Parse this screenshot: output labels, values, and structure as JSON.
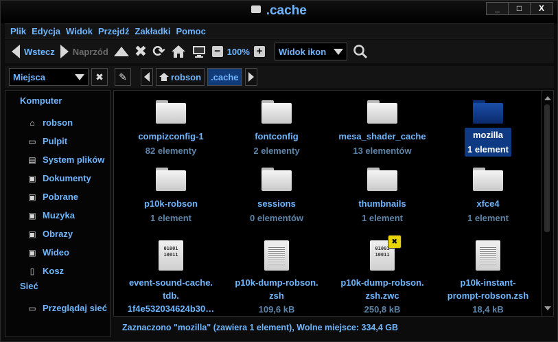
{
  "window": {
    "title": " .cache",
    "controls": [
      "_",
      "□",
      "X"
    ]
  },
  "menu": [
    "Plik",
    "Edycja",
    "Widok",
    "Przejdź",
    "Zakładki",
    "Pomoc"
  ],
  "toolbar": {
    "back": "Wstecz",
    "forward": "Naprzód",
    "zoom": "100%",
    "view_mode": "Widok ikon"
  },
  "location": {
    "places": "Miejsca",
    "crumbs": [
      "robson",
      ".cache"
    ]
  },
  "sidebar": {
    "computer_heading": "Komputer",
    "computer_items": [
      {
        "label": "robson",
        "icon": "home-icon"
      },
      {
        "label": "Pulpit",
        "icon": "desktop-icon"
      },
      {
        "label": "System plików",
        "icon": "drive-icon"
      },
      {
        "label": "Dokumenty",
        "icon": "documents-icon"
      },
      {
        "label": "Pobrane",
        "icon": "downloads-icon"
      },
      {
        "label": "Muzyka",
        "icon": "music-icon"
      },
      {
        "label": "Obrazy",
        "icon": "pictures-icon"
      },
      {
        "label": "Wideo",
        "icon": "video-icon"
      },
      {
        "label": "Kosz",
        "icon": "trash-icon"
      }
    ],
    "network_heading": "Sieć",
    "network_items": [
      {
        "label": "Przeglądaj sieć",
        "icon": "network-icon"
      }
    ]
  },
  "files": [
    {
      "name": "compizconfig-1",
      "info": "82 elementy",
      "kind": "folder"
    },
    {
      "name": "fontconfig",
      "info": "2 elementy",
      "kind": "folder"
    },
    {
      "name": "mesa_shader_cache",
      "info": "13 elementów",
      "kind": "folder"
    },
    {
      "name": "mozilla",
      "info": "1 element",
      "kind": "folder",
      "selected": true
    },
    {
      "name": "p10k-robson",
      "info": "1 element",
      "kind": "folder"
    },
    {
      "name": "sessions",
      "info": "0 elementów",
      "kind": "folder"
    },
    {
      "name": "thumbnails",
      "info": "1 element",
      "kind": "folder"
    },
    {
      "name": "xfce4",
      "info": "1 element",
      "kind": "folder"
    },
    {
      "name": "event-sound-cache.",
      "name2": "tdb.",
      "name3": "1f4e532034624b30…",
      "kind": "binary"
    },
    {
      "name": "p10k-dump-robson.",
      "name2": "zsh",
      "info": "109,6 kB",
      "kind": "text"
    },
    {
      "name": "p10k-dump-robson.",
      "name2": "zsh.zwc",
      "info": "250,8 kB",
      "kind": "binary-x"
    },
    {
      "name": "p10k-instant-",
      "name2": "prompt-robson.zsh",
      "info": "18,4 kB",
      "kind": "text"
    }
  ],
  "binary_glyph": "01001\n10011",
  "status": "Zaznaczono \"mozilla\" (zawiera 1 element), Wolne miejsce: 334,4 GB"
}
